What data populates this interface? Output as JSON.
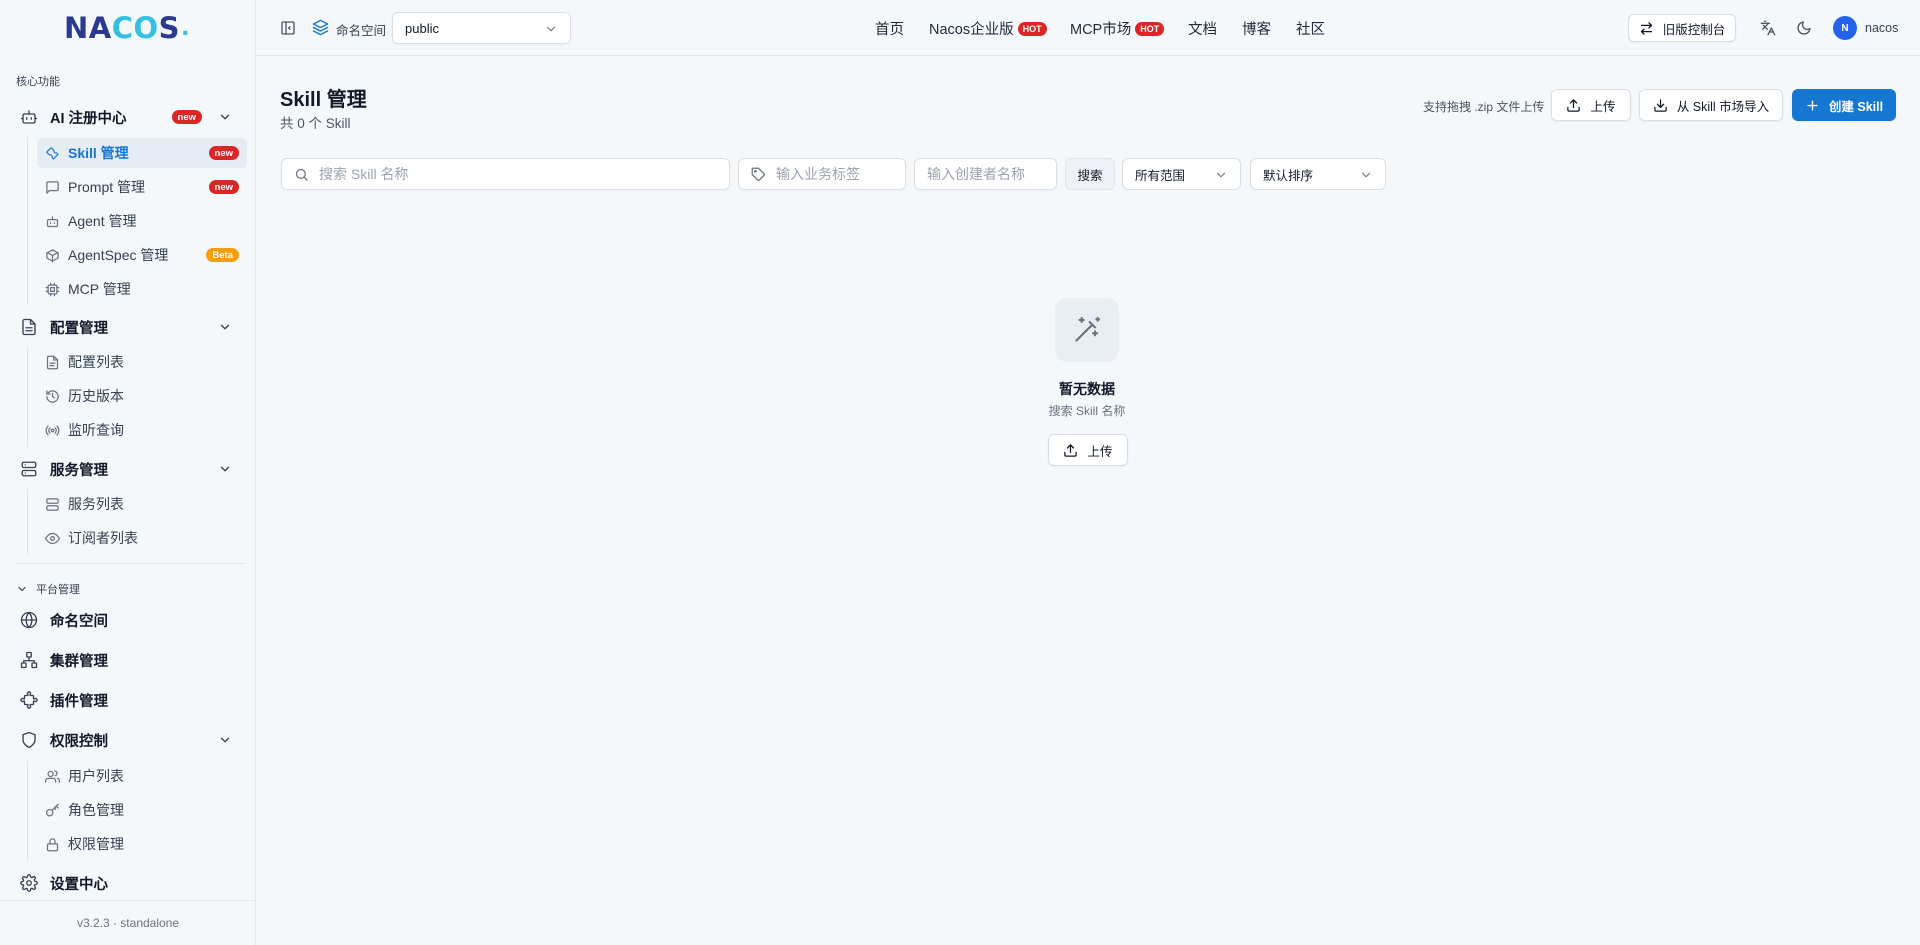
{
  "app": {
    "logo_text_left": "NA",
    "logo_text_mid": "C",
    "logo_text_o": "O",
    "logo_text_right": "S",
    "logo_dot": ".",
    "version": "v3.2.3 · standalone"
  },
  "sidebar": {
    "core_section": "核心功能",
    "ai_registry": {
      "label": "AI 注册中心",
      "badge": "new"
    },
    "ai_items": [
      {
        "label": "Skill 管理",
        "badge": "new"
      },
      {
        "label": "Prompt 管理",
        "badge": "new"
      },
      {
        "label": "Agent 管理",
        "badge": ""
      },
      {
        "label": "AgentSpec 管理",
        "badge": "Beta"
      },
      {
        "label": "MCP 管理",
        "badge": ""
      }
    ],
    "config_mgmt": {
      "label": "配置管理"
    },
    "config_items": [
      {
        "label": "配置列表"
      },
      {
        "label": "历史版本"
      },
      {
        "label": "监听查询"
      }
    ],
    "service_mgmt": {
      "label": "服务管理"
    },
    "service_items": [
      {
        "label": "服务列表"
      },
      {
        "label": "订阅者列表"
      }
    ],
    "platform_section": "平台管理",
    "namespace": "命名空间",
    "cluster": "集群管理",
    "plugin": "插件管理",
    "auth": {
      "label": "权限控制"
    },
    "auth_items": [
      {
        "label": "用户列表"
      },
      {
        "label": "角色管理"
      },
      {
        "label": "权限管理"
      }
    ],
    "settings": "设置中心"
  },
  "topbar": {
    "namespace_label": "命名空间",
    "namespace_value": "public",
    "nav": [
      {
        "label": "首页",
        "badge": ""
      },
      {
        "label": "Nacos企业版",
        "badge": "HOT"
      },
      {
        "label": "MCP市场",
        "badge": "HOT"
      },
      {
        "label": "文档",
        "badge": ""
      },
      {
        "label": "博客",
        "badge": ""
      },
      {
        "label": "社区",
        "badge": ""
      }
    ],
    "legacy_console": "旧版控制台",
    "avatar_initial": "N",
    "username": "nacos"
  },
  "main": {
    "title": "Skill 管理",
    "subtitle": "共 0 个 Skill",
    "upload_hint": "支持拖拽 .zip 文件上传",
    "upload_button": "上传",
    "import_button": "从 Skill 市场导入",
    "create_button": "创建 Skill",
    "search_placeholder": "搜索 Skill 名称",
    "tag_placeholder": "输入业务标签",
    "creator_placeholder": "输入创建者名称",
    "search_button": "搜索",
    "scope_select": "所有范围",
    "sort_select": "默认排序",
    "empty_title": "暂无数据",
    "empty_sub": "搜索 Skill 名称",
    "empty_upload_button": "上传"
  },
  "colors": {
    "accent": "#1677d2",
    "badge_new": "#dc2626",
    "badge_beta": "#f59e0b",
    "background": "#f5f8fb"
  }
}
